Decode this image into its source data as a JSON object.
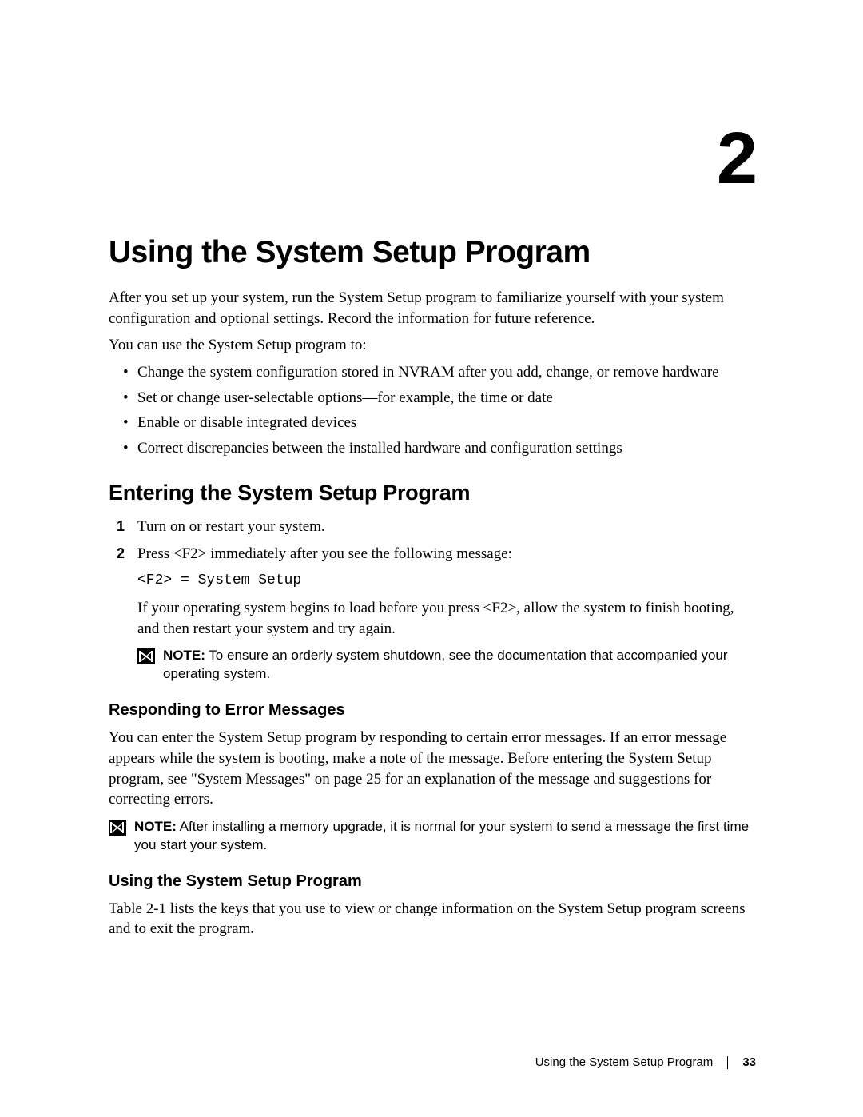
{
  "chapter_number": "2",
  "title": "Using the System Setup Program",
  "intro_p1": "After you set up your system, run the System Setup program to familiarize yourself with your system configuration and optional settings. Record the information for future reference.",
  "intro_p2": "You can use the System Setup program to:",
  "bullets": [
    "Change the system configuration stored in NVRAM after you add, change, or remove hardware",
    "Set or change user-selectable options—for example, the time or date",
    "Enable or disable integrated devices",
    "Correct discrepancies between the installed hardware and configuration settings"
  ],
  "section_entering": {
    "heading": "Entering the System Setup Program",
    "steps": {
      "s1": "Turn on or restart your system.",
      "s2": "Press <F2> immediately after you see the following message:",
      "s2_code": "<F2> = System Setup",
      "s2_cont": "If your operating system begins to load before you press <F2>, allow the system to finish booting, and then restart your system and try again."
    },
    "note_label": "NOTE:",
    "note_text": " To ensure an orderly system shutdown, see the documentation that accompanied your operating system."
  },
  "section_responding": {
    "heading": "Responding to Error Messages",
    "body": "You can enter the System Setup program by responding to certain error messages. If an error message appears while the system is booting, make a note of the message. Before entering the System Setup program, see \"System Messages\" on page 25 for an explanation of the message and suggestions for correcting errors.",
    "note_label": "NOTE:",
    "note_text": " After installing a memory upgrade, it is normal for your system to send a message the first time you start your system."
  },
  "section_using": {
    "heading": "Using the System Setup Program",
    "body": "Table 2-1 lists the keys that you use to view or change information on the System Setup program screens and to exit the program."
  },
  "footer": {
    "running_title": "Using the System Setup Program",
    "page_number": "33"
  }
}
